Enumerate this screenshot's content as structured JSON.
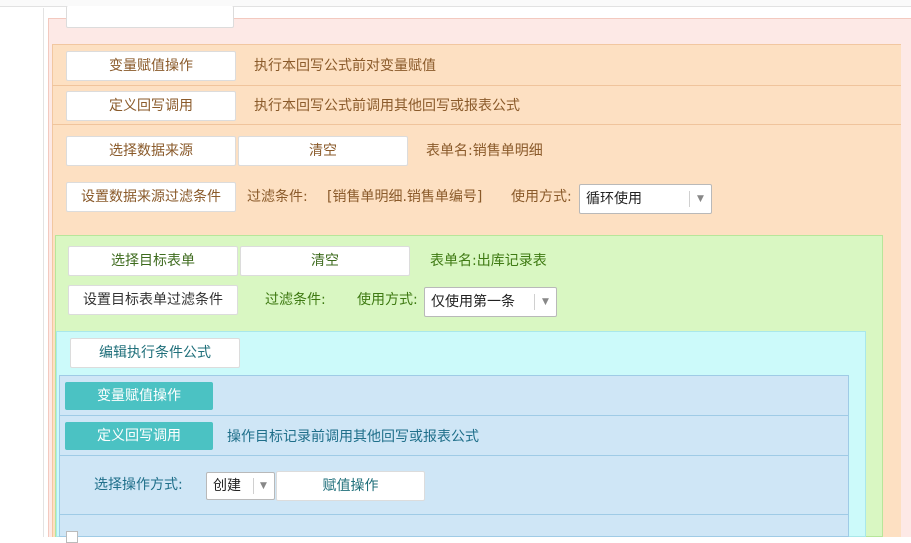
{
  "orange_section": {
    "var_assign_button": "变量赋值操作",
    "var_assign_desc": "执行本回写公式前对变量赋值",
    "define_call_button": "定义回写调用",
    "define_call_desc": "执行本回写公式前调用其他回写或报表公式",
    "select_source_button": "选择数据来源",
    "clear_button": "清空",
    "source_table_label": "表单名:销售单明细",
    "source_filter_button": "设置数据来源过滤条件",
    "filter_label": "过滤条件:",
    "filter_value": "[销售单明细.销售单编号]",
    "usage_label": "使用方式:",
    "usage_select": "循环使用"
  },
  "green_section": {
    "select_target_button": "选择目标表单",
    "clear_button": "清空",
    "target_table_label": "表单名:出库记录表",
    "target_filter_button": "设置目标表单过滤条件",
    "filter_label": "过滤条件:",
    "usage_label": "使用方式:",
    "usage_select": "仅使用第一条"
  },
  "cyan_section": {
    "edit_condition_button": "编辑执行条件公式"
  },
  "blue_section": {
    "var_assign_button": "变量赋值操作",
    "define_call_button": "定义回写调用",
    "define_call_desc": "操作目标记录前调用其他回写或报表公式",
    "operation_label": "选择操作方式:",
    "operation_select": "创建",
    "assign_button": "赋值操作"
  },
  "colors": {
    "orange_bg": "#fde0c2",
    "green_bg": "#d9f7c2",
    "cyan_bg": "#ccfafa",
    "blue_bg": "#cfe6f6",
    "teal_button": "#4bc2c3"
  }
}
